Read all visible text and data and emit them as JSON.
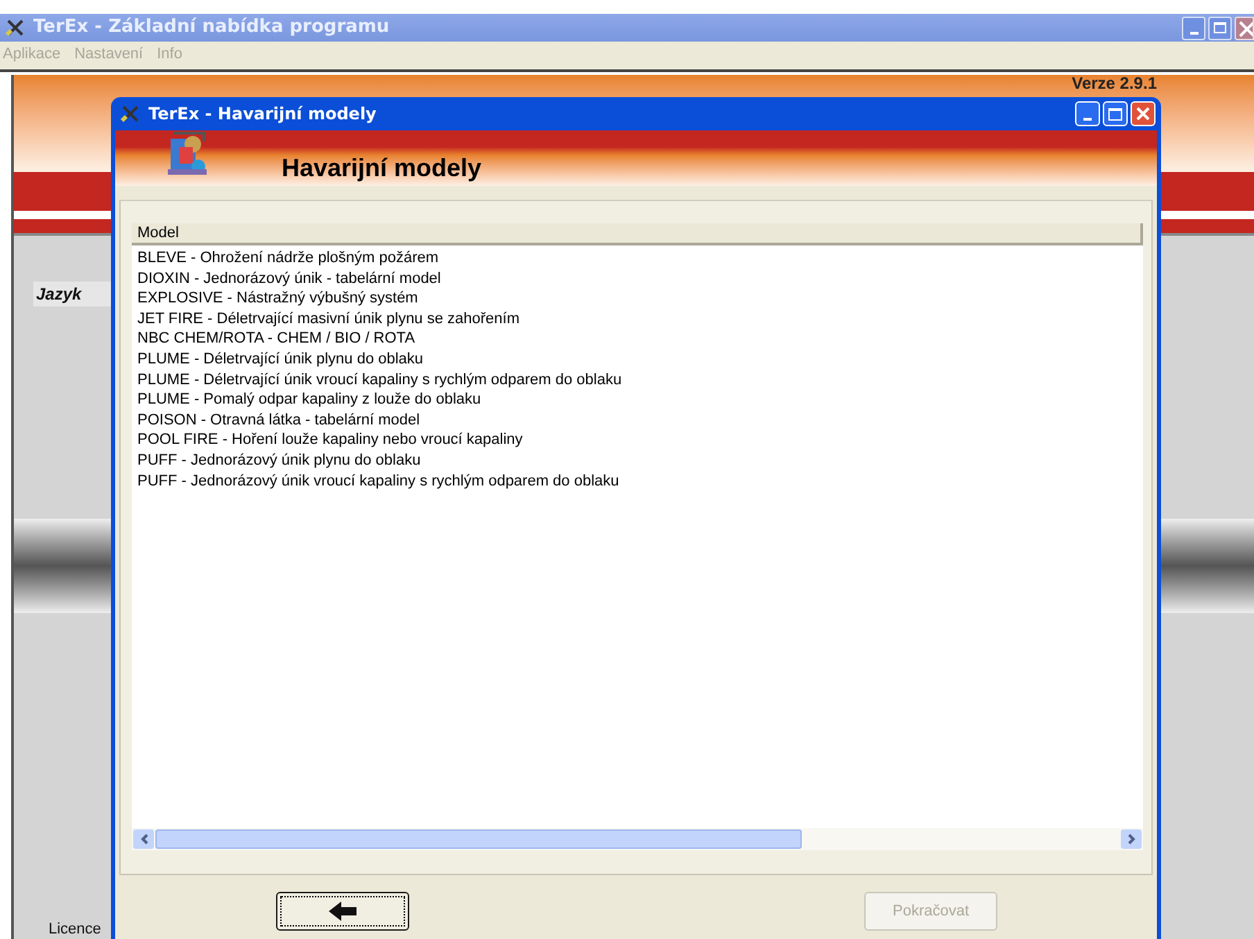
{
  "main_window": {
    "title": "TerEx  - Základní nabídka programu",
    "menu": [
      "Aplikace",
      "Nastavení",
      "Info"
    ],
    "version": "Verze 2.9.1",
    "language_label": "Jazyk",
    "license_label": "Licence"
  },
  "dialog": {
    "title": "TerEx  - Havarijní modely",
    "heading": "Havarijní modely",
    "list": {
      "column": "Model",
      "rows": [
        {
          "text": "BLEVE - Ohrožení nádrže plošným požárem",
          "selected": false
        },
        {
          "text": "DIOXIN - Jednorázový únik - tabelární model",
          "selected": false
        },
        {
          "text": "EXPLOSIVE - Nástražný výbušný systém",
          "selected": false
        },
        {
          "text": "JET FIRE - Déletrvající masivní únik plynu se zahořením",
          "selected": false
        },
        {
          "text": "NBC CHEM/ROTA - CHEM / BIO / ROTA",
          "selected": false
        },
        {
          "text": "PLUME - Déletrvající únik plynu do oblaku",
          "selected": false
        },
        {
          "text": "PLUME - Déletrvající únik vroucí kapaliny s rychlým odparem do oblaku",
          "selected": false
        },
        {
          "text": "PLUME - Pomalý odpar kapaliny z louže do oblaku",
          "selected": false
        },
        {
          "text": "POISON - Otravná látka - tabelární model",
          "selected": false
        },
        {
          "text": "POOL FIRE - Hoření louže kapaliny nebo vroucí kapaliny",
          "selected": false
        },
        {
          "text": "PUFF - Jednorázový únik plynu do oblaku",
          "selected": false
        },
        {
          "text": "PUFF - Jednorázový únik vroucí kapaliny s rychlým odparem do oblaku",
          "selected": false
        }
      ]
    },
    "buttons": [
      {
        "kind": "back",
        "disabled": false
      },
      {
        "kind": "text",
        "label": "Pokračovat",
        "disabled": true
      }
    ]
  }
}
